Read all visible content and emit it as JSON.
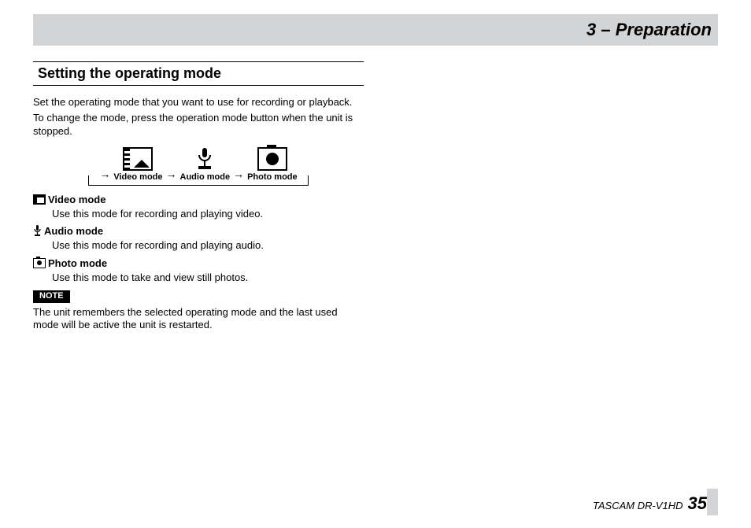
{
  "header": {
    "chapter_title": "3 – Preparation"
  },
  "section": {
    "heading": "Setting the operating mode"
  },
  "intro": {
    "p1": "Set the operating mode that you want to use for recording or playback.",
    "p2": "To change the mode, press the operation mode button when the unit is stopped."
  },
  "diagram": {
    "arrow": "→",
    "items": [
      {
        "label": "Video mode"
      },
      {
        "label": "Audio mode"
      },
      {
        "label": "Photo mode"
      }
    ]
  },
  "modes": {
    "video": {
      "title": "Video mode",
      "desc": "Use this mode for recording and playing video."
    },
    "audio": {
      "title": "Audio mode",
      "desc": "Use this mode for recording and playing audio."
    },
    "photo": {
      "title": "Photo mode",
      "desc": "Use this mode to take and view still photos."
    }
  },
  "note": {
    "tag": "NOTE",
    "text": "The unit remembers the selected operating mode and the last used mode will be active the unit is restarted."
  },
  "footer": {
    "product": "TASCAM  DR-V1HD",
    "page_number": "35"
  }
}
